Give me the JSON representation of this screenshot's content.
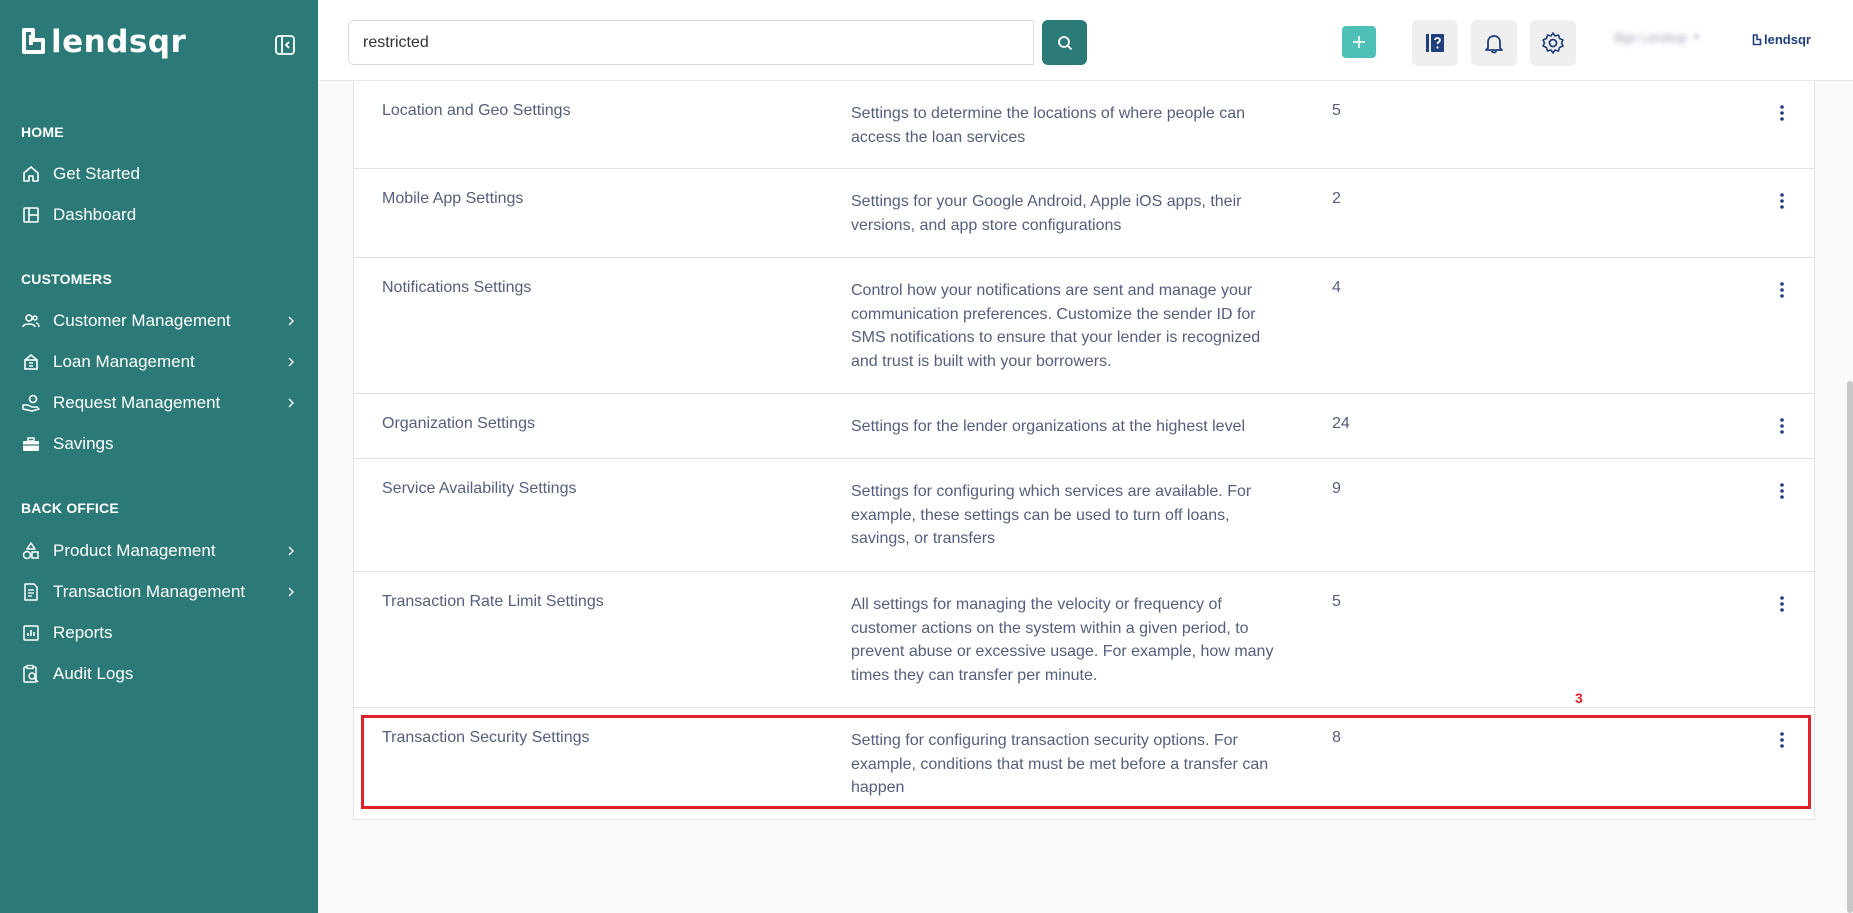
{
  "brand": {
    "name": "lendsqr"
  },
  "sidebar": {
    "sections": [
      {
        "label": "HOME"
      },
      {
        "label": "CUSTOMERS"
      },
      {
        "label": "BACK OFFICE"
      }
    ],
    "items": [
      {
        "label": "Get Started",
        "icon": "home-icon"
      },
      {
        "label": "Dashboard",
        "icon": "dashboard-icon"
      },
      {
        "label": "Customer Management",
        "icon": "users-icon",
        "has_submenu": true
      },
      {
        "label": "Loan Management",
        "icon": "loan-icon",
        "has_submenu": true
      },
      {
        "label": "Request Management",
        "icon": "request-icon",
        "has_submenu": true
      },
      {
        "label": "Savings",
        "icon": "savings-icon"
      },
      {
        "label": "Product Management",
        "icon": "product-icon",
        "has_submenu": true
      },
      {
        "label": "Transaction Management",
        "icon": "transaction-icon",
        "has_submenu": true
      },
      {
        "label": "Reports",
        "icon": "reports-icon"
      },
      {
        "label": "Audit Logs",
        "icon": "audit-icon"
      }
    ]
  },
  "header": {
    "search_value": "restricted",
    "user_name": "Bgo Lendsqr",
    "brand_small": "lendsqr"
  },
  "settings": [
    {
      "name": "Location and Geo Settings",
      "description": "Settings to determine the locations of where people can access the loan services",
      "count": "5"
    },
    {
      "name": "Mobile App Settings",
      "description": "Settings for your Google Android, Apple iOS apps, their versions, and app store configurations",
      "count": "2"
    },
    {
      "name": "Notifications Settings",
      "description": "Control how your notifications are sent and manage your communication preferences. Customize the sender ID for SMS notifications to ensure that your lender is recognized and trust is built with your borrowers.",
      "count": "4"
    },
    {
      "name": "Organization Settings",
      "description": "Settings for the lender organizations at the highest level",
      "count": "24"
    },
    {
      "name": "Service Availability Settings",
      "description": "Settings for configuring which services are available. For example, these settings can be used to turn off loans, savings, or transfers",
      "count": "9"
    },
    {
      "name": "Transaction Rate Limit Settings",
      "description": "All settings for managing the velocity or frequency of customer actions on the system within a given period, to prevent abuse or excessive usage. For example, how many times they can transfer per minute.",
      "count": "5"
    },
    {
      "name": "Transaction Security Settings",
      "description": "Setting for configuring transaction security options. For example, conditions that must be met before a transfer can happen",
      "count": "8"
    }
  ],
  "annotation": {
    "label": "3",
    "color": "#e0202a"
  },
  "colors": {
    "sidebar": "#2b7a78",
    "accent": "#4ec0b8",
    "text": "#545f7d"
  }
}
